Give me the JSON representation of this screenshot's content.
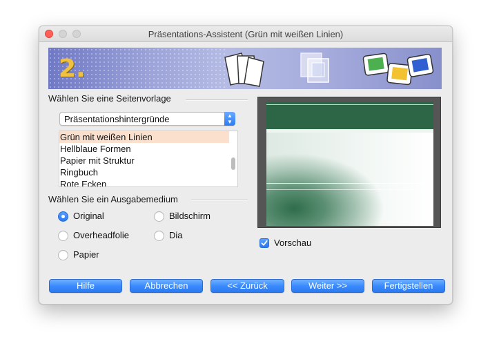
{
  "window": {
    "title": "Präsentations-Assistent (Grün mit weißen Linien)"
  },
  "banner": {
    "step": "2."
  },
  "template_section": {
    "label": "Wählen Sie eine Seitenvorlage",
    "category_selected": "Präsentationshintergründe",
    "items": [
      {
        "label": "Grün mit weißen Linien",
        "selected": true
      },
      {
        "label": "Hellblaue Formen",
        "selected": false
      },
      {
        "label": "Papier mit Struktur",
        "selected": false
      },
      {
        "label": "Ringbuch",
        "selected": false
      },
      {
        "label": "Rote Ecken",
        "selected": false
      }
    ]
  },
  "medium_section": {
    "label": "Wählen Sie ein Ausgabemedium",
    "options": [
      {
        "label": "Original",
        "checked": true
      },
      {
        "label": "Bildschirm",
        "checked": false
      },
      {
        "label": "Overheadfolie",
        "checked": false
      },
      {
        "label": "Dia",
        "checked": false
      },
      {
        "label": "Papier",
        "checked": false
      }
    ]
  },
  "preview": {
    "checkbox_label": "Vorschau",
    "checked": true,
    "accent_color": "#2c6646"
  },
  "buttons": {
    "help": "Hilfe",
    "cancel": "Abbrechen",
    "back": "<< Zurück",
    "next": "Weiter >>",
    "finish": "Fertigstellen"
  },
  "colors": {
    "accent": "#2b79ee",
    "selection": "#fbe1cd",
    "banner": "#9aa2d8"
  }
}
